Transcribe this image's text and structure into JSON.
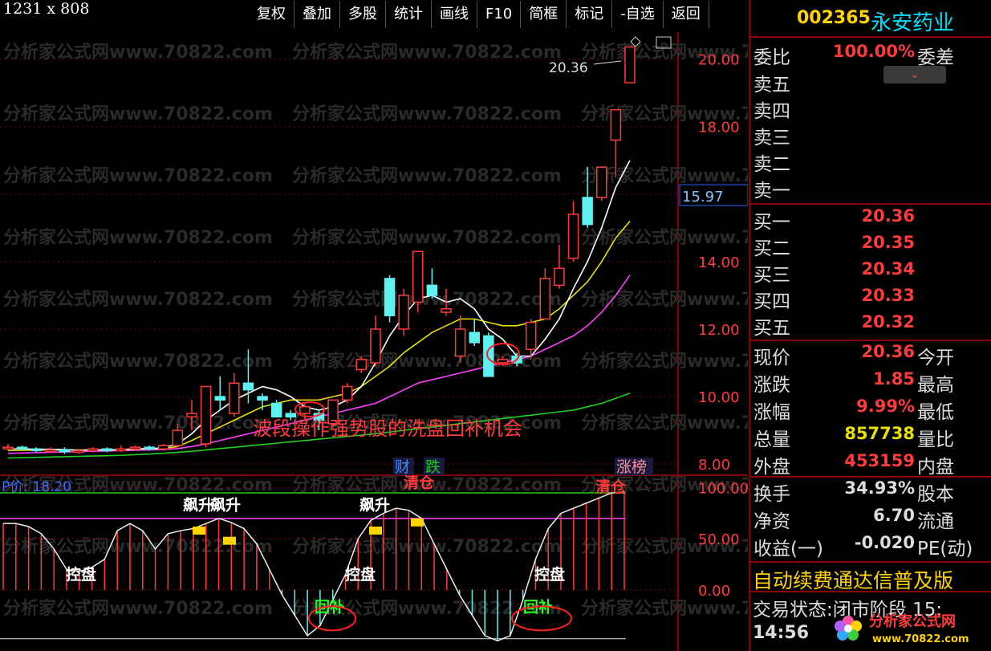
{
  "screenshot_label": "1231 x 808",
  "toolbar": [
    "复权",
    "叠加",
    "多股",
    "统计",
    "画线",
    "F10",
    "简框",
    "标记",
    "-自选",
    "返回"
  ],
  "stock": {
    "code": "002365",
    "name": "永安药业"
  },
  "order_ratio": {
    "label": "委比",
    "value": "100.00%",
    "label2": "委差"
  },
  "sells": [
    "卖五",
    "卖四",
    "卖三",
    "卖二",
    "卖一"
  ],
  "buys": [
    {
      "label": "买一",
      "price": "20.36"
    },
    {
      "label": "买二",
      "price": "20.35"
    },
    {
      "label": "买三",
      "price": "20.34"
    },
    {
      "label": "买四",
      "price": "20.33"
    },
    {
      "label": "买五",
      "price": "20.32"
    }
  ],
  "quote": [
    {
      "label": "现价",
      "value": "20.36",
      "label2": "今开",
      "color": "#ff3b3b"
    },
    {
      "label": "涨跌",
      "value": "1.85",
      "label2": "最高",
      "color": "#ff3b3b"
    },
    {
      "label": "涨幅",
      "value": "9.99%",
      "label2": "最低",
      "color": "#ff3b3b"
    },
    {
      "label": "总量",
      "value": "857738",
      "label2": "量比",
      "color": "#e8e000"
    },
    {
      "label": "外盘",
      "value": "453159",
      "label2": "内盘",
      "color": "#ff3b3b"
    }
  ],
  "finance": [
    {
      "label": "换手",
      "value": "34.93%",
      "label2": "股本"
    },
    {
      "label": "净资",
      "value": "6.70",
      "label2": "流通"
    },
    {
      "label": "收益(一)",
      "value": "-0.020",
      "label2": "PE(动)"
    }
  ],
  "ad_text": "自动续费通达信普及版",
  "trade_state": "交易状态:闭市阶段 15:",
  "time": "14:56",
  "logo_text": "分析家公式网",
  "logo_url": "www.70822.com",
  "watermark": "分析家公式网www.70822.com",
  "price_axis": [
    20.0,
    18.0,
    16.0,
    14.0,
    12.0,
    10.0,
    8.0
  ],
  "current_price_tag": "15.97",
  "last_price_note": "20.36",
  "annotation_main": "波段操作强势股的洗盘回补机会",
  "badges": [
    {
      "text": "财",
      "color": "#3a8cff"
    },
    {
      "text": "跌",
      "color": "#18c818"
    },
    {
      "text": "涨榜",
      "color": "#ff9090"
    }
  ],
  "indicator_title": "P价: 18.20",
  "indicator_axis": [
    100.0,
    50.0,
    0.0
  ],
  "indicator_labels": [
    "飙升",
    "飙升",
    "清仓",
    "飙升",
    "清仓",
    "控盘",
    "控盘",
    "控盘",
    "回补",
    "回补"
  ],
  "colors": {
    "up": "#ff3b3b",
    "down": "#5ff0f0",
    "ma5": "#ffffff",
    "ma10": "#e8e000",
    "ma20": "#ff40ff",
    "ma60": "#20d020",
    "grid": "#8a0000"
  },
  "chart_data": {
    "type": "candlestick",
    "ylim": [
      7.6,
      20.8
    ],
    "candles": [
      {
        "o": 8.45,
        "c": 8.5,
        "h": 8.6,
        "l": 8.4
      },
      {
        "o": 8.5,
        "c": 8.45,
        "h": 8.55,
        "l": 8.4
      },
      {
        "o": 8.45,
        "c": 8.4,
        "h": 8.5,
        "l": 8.35
      },
      {
        "o": 8.4,
        "c": 8.42,
        "h": 8.5,
        "l": 8.35
      },
      {
        "o": 8.42,
        "c": 8.38,
        "h": 8.5,
        "l": 8.3
      },
      {
        "o": 8.38,
        "c": 8.4,
        "h": 8.45,
        "l": 8.3
      },
      {
        "o": 8.4,
        "c": 8.45,
        "h": 8.5,
        "l": 8.35
      },
      {
        "o": 8.45,
        "c": 8.4,
        "h": 8.5,
        "l": 8.35
      },
      {
        "o": 8.4,
        "c": 8.45,
        "h": 8.55,
        "l": 8.35
      },
      {
        "o": 8.45,
        "c": 8.5,
        "h": 8.55,
        "l": 8.4
      },
      {
        "o": 8.5,
        "c": 8.45,
        "h": 8.55,
        "l": 8.4
      },
      {
        "o": 8.45,
        "c": 8.55,
        "h": 8.6,
        "l": 8.4
      },
      {
        "o": 8.55,
        "c": 9.0,
        "h": 9.2,
        "l": 8.5
      },
      {
        "o": 9.4,
        "c": 9.5,
        "h": 9.9,
        "l": 9.0
      },
      {
        "o": 8.6,
        "c": 10.3,
        "h": 10.3,
        "l": 8.5
      },
      {
        "o": 10.0,
        "c": 9.9,
        "h": 10.6,
        "l": 9.6
      },
      {
        "o": 9.5,
        "c": 10.4,
        "h": 10.7,
        "l": 9.4
      },
      {
        "o": 10.4,
        "c": 10.2,
        "h": 11.4,
        "l": 9.8
      },
      {
        "o": 10.0,
        "c": 9.9,
        "h": 10.1,
        "l": 9.6
      },
      {
        "o": 9.8,
        "c": 9.4,
        "h": 9.9,
        "l": 9.4
      },
      {
        "o": 9.5,
        "c": 9.4,
        "h": 9.6,
        "l": 9.3
      },
      {
        "o": 9.5,
        "c": 9.7,
        "h": 9.8,
        "l": 9.3
      },
      {
        "o": 9.5,
        "c": 9.3,
        "h": 9.6,
        "l": 9.0
      },
      {
        "o": 9.2,
        "c": 9.9,
        "h": 9.9,
        "l": 9.1
      },
      {
        "o": 9.9,
        "c": 10.3,
        "h": 10.4,
        "l": 9.8
      },
      {
        "o": 10.8,
        "c": 11.1,
        "h": 11.2,
        "l": 10.7
      },
      {
        "o": 11.0,
        "c": 12.0,
        "h": 12.4,
        "l": 10.9
      },
      {
        "o": 13.5,
        "c": 12.4,
        "h": 13.6,
        "l": 12.2
      },
      {
        "o": 12.0,
        "c": 13.0,
        "h": 13.2,
        "l": 11.8
      },
      {
        "o": 12.8,
        "c": 14.3,
        "h": 14.3,
        "l": 12.5
      },
      {
        "o": 13.3,
        "c": 13.0,
        "h": 13.8,
        "l": 12.9
      },
      {
        "o": 12.5,
        "c": 12.6,
        "h": 13.2,
        "l": 12.4
      },
      {
        "o": 11.2,
        "c": 12.0,
        "h": 12.4,
        "l": 11.0
      },
      {
        "o": 11.9,
        "c": 11.6,
        "h": 12.3,
        "l": 11.5
      },
      {
        "o": 11.8,
        "c": 10.6,
        "h": 11.9,
        "l": 10.6
      },
      {
        "o": 11.0,
        "c": 11.1,
        "h": 11.2,
        "l": 10.9
      },
      {
        "o": 11.2,
        "c": 11.0,
        "h": 11.3,
        "l": 10.9
      },
      {
        "o": 11.4,
        "c": 12.2,
        "h": 12.3,
        "l": 11.1
      },
      {
        "o": 12.3,
        "c": 13.5,
        "h": 13.8,
        "l": 12.3
      },
      {
        "o": 13.3,
        "c": 13.8,
        "h": 14.5,
        "l": 13.2
      },
      {
        "o": 14.1,
        "c": 15.4,
        "h": 15.8,
        "l": 14.0
      },
      {
        "o": 15.9,
        "c": 15.1,
        "h": 16.8,
        "l": 15.0
      },
      {
        "o": 15.9,
        "c": 16.8,
        "h": 16.8,
        "l": 15.8
      },
      {
        "o": 17.6,
        "c": 18.5,
        "h": 18.5,
        "l": 16.5
      },
      {
        "o": 19.3,
        "c": 20.36,
        "h": 20.36,
        "l": 19.3
      }
    ],
    "ma5": [
      8.45,
      8.45,
      8.44,
      8.44,
      8.43,
      8.41,
      8.42,
      8.42,
      8.43,
      8.45,
      8.46,
      8.48,
      8.6,
      8.9,
      9.3,
      9.6,
      9.9,
      10.1,
      10.3,
      10.2,
      10.0,
      9.7,
      9.6,
      9.7,
      9.9,
      10.3,
      11.0,
      11.8,
      12.4,
      12.9,
      13.0,
      12.8,
      12.9,
      12.6,
      12.0,
      11.7,
      11.2,
      11.2,
      11.7,
      12.3,
      13.2,
      14.0,
      15.0,
      16.2,
      17.0
    ],
    "ma10": [
      8.4,
      8.41,
      8.42,
      8.42,
      8.42,
      8.42,
      8.42,
      8.42,
      8.43,
      8.44,
      8.45,
      8.46,
      8.52,
      8.7,
      8.9,
      9.1,
      9.3,
      9.5,
      9.7,
      9.8,
      9.9,
      9.9,
      9.9,
      10.0,
      10.1,
      10.3,
      10.6,
      10.9,
      11.3,
      11.6,
      11.9,
      12.1,
      12.3,
      12.3,
      12.2,
      12.1,
      12.1,
      12.2,
      12.3,
      12.6,
      13.0,
      13.4,
      14.0,
      14.7,
      15.2
    ],
    "ma20": [
      8.32,
      8.33,
      8.34,
      8.35,
      8.36,
      8.37,
      8.38,
      8.39,
      8.4,
      8.41,
      8.42,
      8.43,
      8.46,
      8.52,
      8.6,
      8.7,
      8.8,
      8.9,
      9.0,
      9.1,
      9.2,
      9.3,
      9.4,
      9.5,
      9.6,
      9.7,
      9.8,
      10.0,
      10.2,
      10.4,
      10.5,
      10.6,
      10.7,
      10.8,
      10.9,
      11.0,
      11.1,
      11.2,
      11.4,
      11.6,
      11.8,
      12.1,
      12.5,
      13.0,
      13.6
    ],
    "ma60": [
      8.18,
      8.19,
      8.2,
      8.21,
      8.22,
      8.23,
      8.24,
      8.25,
      8.26,
      8.28,
      8.3,
      8.32,
      8.35,
      8.38,
      8.42,
      8.46,
      8.5,
      8.54,
      8.58,
      8.62,
      8.66,
      8.7,
      8.74,
      8.78,
      8.82,
      8.86,
      8.9,
      8.95,
      9.0,
      9.05,
      9.1,
      9.15,
      9.2,
      9.25,
      9.3,
      9.35,
      9.4,
      9.45,
      9.5,
      9.55,
      9.6,
      9.7,
      9.8,
      9.95,
      10.1
    ],
    "indicator": [
      65,
      65,
      62,
      55,
      40,
      20,
      18,
      22,
      30,
      58,
      65,
      58,
      40,
      55,
      58,
      60,
      65,
      70,
      66,
      60,
      45,
      20,
      -5,
      -25,
      -45,
      -35,
      -10,
      15,
      50,
      68,
      75,
      80,
      78,
      70,
      45,
      20,
      -5,
      -25,
      -45,
      -50,
      -45,
      -10,
      30,
      60,
      75,
      80,
      85,
      90,
      95,
      96
    ],
    "indicator_ylim": [
      -60,
      110
    ]
  }
}
